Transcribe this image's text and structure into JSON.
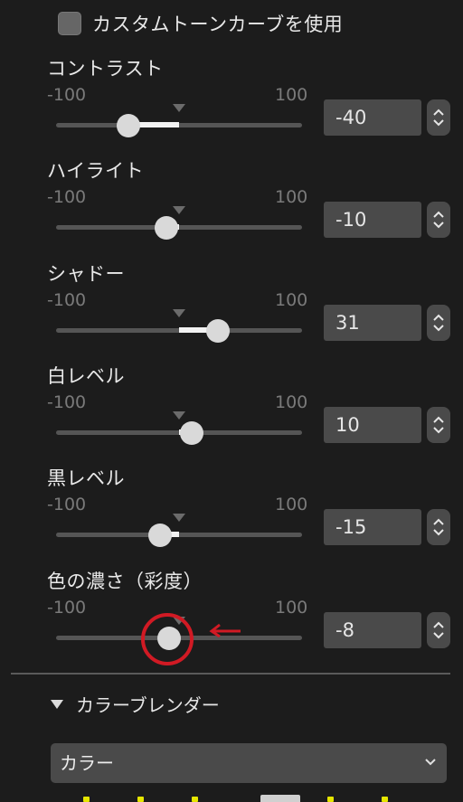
{
  "custom_curve": {
    "label": "カスタムトーンカーブを使用",
    "checked": false
  },
  "sliders": [
    {
      "title": "コントラスト",
      "min": "-100",
      "max": "100",
      "value": "-40",
      "numeric": -40
    },
    {
      "title": "ハイライト",
      "min": "-100",
      "max": "100",
      "value": "-10",
      "numeric": -10
    },
    {
      "title": "シャドー",
      "min": "-100",
      "max": "100",
      "value": "31",
      "numeric": 31
    },
    {
      "title": "白レベル",
      "min": "-100",
      "max": "100",
      "value": "10",
      "numeric": 10
    },
    {
      "title": "黒レベル",
      "min": "-100",
      "max": "100",
      "value": "-15",
      "numeric": -15
    },
    {
      "title": "色の濃さ（彩度）",
      "min": "-100",
      "max": "100",
      "value": "-8",
      "numeric": -8
    }
  ],
  "color_blender": {
    "title": "カラーブレンダー",
    "dropdown_value": "カラー"
  },
  "colors": {
    "background": "#1c1c1c",
    "annotation": "#d11a24",
    "swatch_dots": "#e6e600"
  }
}
